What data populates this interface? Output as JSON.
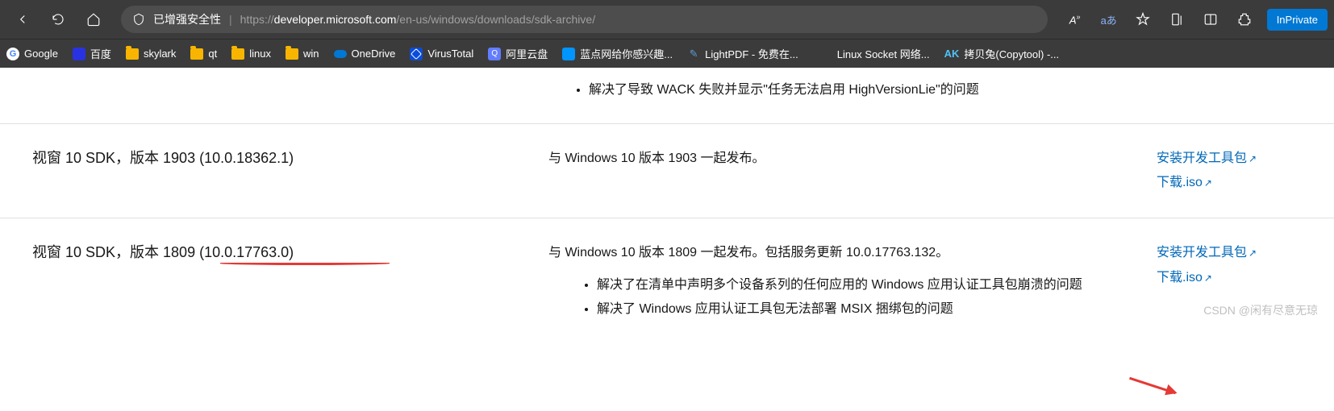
{
  "toolbar": {
    "security_label": "已增强安全性",
    "url_prefix": "https://",
    "url_host": "developer.microsoft.com",
    "url_path": "/en-us/windows/downloads/sdk-archive/",
    "translate_label": "aあ",
    "inprivate_label": "InPrivate"
  },
  "bookmarks": [
    {
      "label": "Google",
      "icon": "google"
    },
    {
      "label": "百度",
      "icon": "baidu"
    },
    {
      "label": "skylark",
      "icon": "folder"
    },
    {
      "label": "qt",
      "icon": "folder"
    },
    {
      "label": "linux",
      "icon": "folder"
    },
    {
      "label": "win",
      "icon": "folder"
    },
    {
      "label": "OneDrive",
      "icon": "cloud"
    },
    {
      "label": "VirusTotal",
      "icon": "vt"
    },
    {
      "label": "阿里云盘",
      "icon": "ali"
    },
    {
      "label": "蓝点网给你感兴趣...",
      "icon": "blue"
    },
    {
      "label": "LightPDF - 免费在...",
      "icon": "pen"
    },
    {
      "label": "Linux Socket 网络...",
      "icon": "none"
    },
    {
      "label": "拷贝兔(Copytool) -...",
      "icon": "ak",
      "prefix": "AK"
    }
  ],
  "prev_bullet": "解决了导致 WACK 失败并显示\"任务无法启用 HighVersionLie\"的问题",
  "row1": {
    "name": "视窗 10 SDK，版本 1903   (10.0.18362.1)",
    "desc": "与 Windows 10 版本 1903 一起发布。",
    "link1": "安装开发工具包",
    "link2": "下载.iso"
  },
  "row2": {
    "name": "视窗 10 SDK，版本 1809   (10.0.17763.0)",
    "desc": "与 Windows 10 版本 1809 一起发布。包括服务更新 10.0.17763.132。",
    "bullets": [
      "解决了在清单中声明多个设备系列的任何应用的 Windows 应用认证工具包崩溃的问题",
      "解决了 Windows 应用认证工具包无法部署 MSIX 捆绑包的问题"
    ],
    "link1": "安装开发工具包",
    "link2": "下载.iso"
  },
  "watermark": "CSDN @闲有尽意无琼"
}
